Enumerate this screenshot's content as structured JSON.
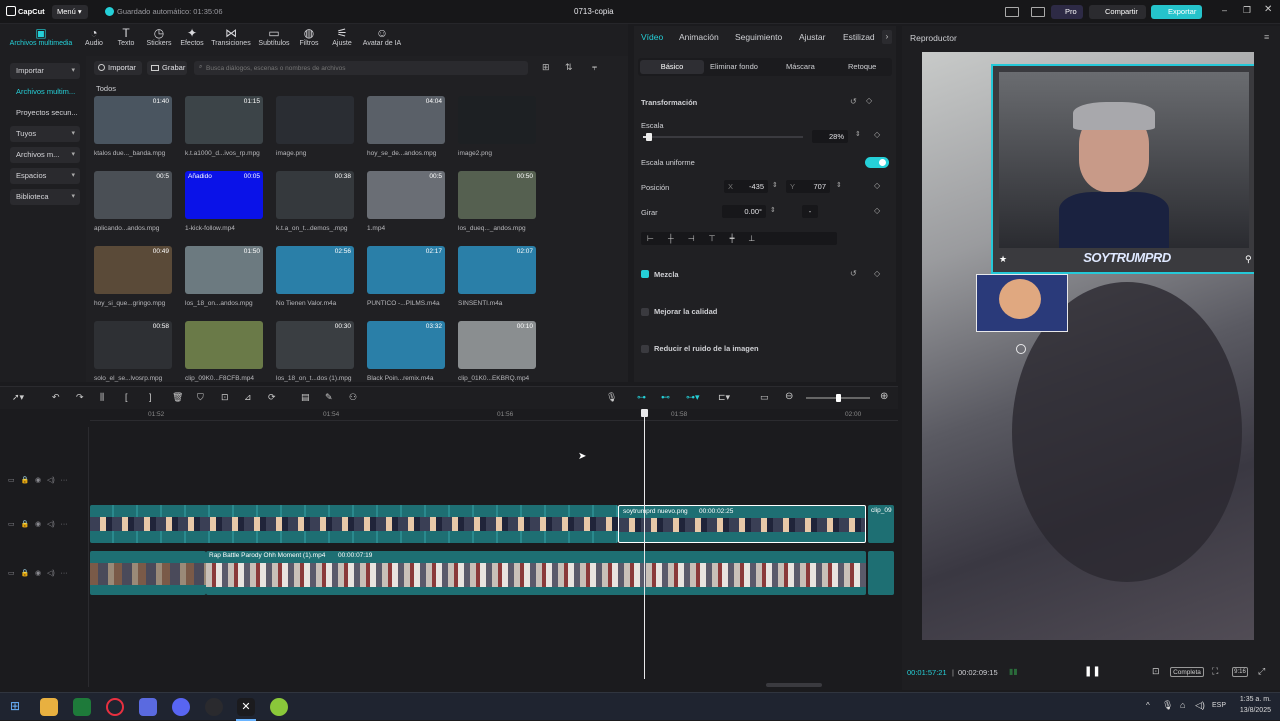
{
  "titlebar": {
    "app": "CapCut",
    "menu": "Menú",
    "autosave": "Guardado automático: 01:35:06",
    "project": "0713-copia",
    "pro": "Pro",
    "share": "Compartir",
    "export": "Exportar"
  },
  "media_tabs": [
    {
      "label": "Archivos multimedia",
      "icon": "media-icon"
    },
    {
      "label": "Audio",
      "icon": "audio-icon"
    },
    {
      "label": "Texto",
      "icon": "text-icon"
    },
    {
      "label": "Stickers",
      "icon": "sticker-icon"
    },
    {
      "label": "Efectos",
      "icon": "effects-icon"
    },
    {
      "label": "Transiciones",
      "icon": "transitions-icon"
    },
    {
      "label": "Subtítulos",
      "icon": "subtitles-icon"
    },
    {
      "label": "Filtros",
      "icon": "filters-icon"
    },
    {
      "label": "Ajuste",
      "icon": "adjust-icon"
    },
    {
      "label": "Avatar de IA",
      "icon": "avatar-icon"
    }
  ],
  "sidebar": [
    "Importar",
    "Archivos multim...",
    "Proyectos secun...",
    "Tuyos",
    "Archivos m...",
    "Espacios",
    "Biblioteca"
  ],
  "media": {
    "import": "Importar",
    "record": "Grabar",
    "search_placeholder": "Busca diálogos, escenas o nombres de archivos",
    "section": "Todos"
  },
  "media_items": [
    {
      "name": "ktalos due..._banda.mpg",
      "dur": "01:40",
      "color": "#4a5560"
    },
    {
      "name": "k.t.a1000_d...ivos_rp.mpg",
      "dur": "01:15",
      "color": "#3c4448"
    },
    {
      "name": "image.png",
      "dur": "",
      "color": "#2a2d33"
    },
    {
      "name": "hoy_se_de...andos.mpg",
      "dur": "04:04",
      "color": "#5a6068"
    },
    {
      "name": "image2.png",
      "dur": "",
      "color": "#1d2023"
    },
    {
      "name": "aplicando...andos.mpg",
      "dur": "00:5",
      "color": "#4a4f55"
    },
    {
      "name": "1-kick-follow.mp4",
      "dur": "00:05",
      "color": "#0a12e8",
      "badge": "Añadido"
    },
    {
      "name": "k.t.a_on_t...demos_.mpg",
      "dur": "00:38",
      "color": "#35393d"
    },
    {
      "name": "1.mp4",
      "dur": "00:5",
      "color": "#6a6e75"
    },
    {
      "name": "los_dueq..._andos.mpg",
      "dur": "00:50",
      "color": "#556050"
    },
    {
      "name": "hoy_si_que...gringo.mpg",
      "dur": "00:49",
      "color": "#5a4a38"
    },
    {
      "name": "los_18_on...andos.mpg",
      "dur": "01:50",
      "color": "#6c7a80"
    },
    {
      "name": "No Tienen Valor.m4a",
      "dur": "02:56",
      "color": "#2a7fa8"
    },
    {
      "name": "PUNTICO -...PILMS.m4a",
      "dur": "02:17",
      "color": "#2a7fa8"
    },
    {
      "name": "SINSENTI.m4a",
      "dur": "02:07",
      "color": "#2a7fa8"
    },
    {
      "name": "solo_el_se...lvosrp.mpg",
      "dur": "00:58",
      "color": "#2e3034"
    },
    {
      "name": "clip_09K0...F8CFB.mp4",
      "dur": "",
      "color": "#6a7a48"
    },
    {
      "name": "los_18_on_t...dos (1).mpg",
      "dur": "00:30",
      "color": "#3a3e42"
    },
    {
      "name": "Black Poin...remix.m4a",
      "dur": "03:32",
      "color": "#2a7fa8"
    },
    {
      "name": "clip_01K0...EKBRQ.mp4",
      "dur": "00:10",
      "color": "#8a8e90"
    }
  ],
  "props": {
    "tabs": [
      "Vídeo",
      "Animación",
      "Seguimiento",
      "Ajustar",
      "Estilizad"
    ],
    "subtabs": [
      "Básico",
      "Eliminar fondo",
      "Máscara",
      "Retoque"
    ],
    "transform": "Transformación",
    "scale_label": "Escala",
    "scale_value": "28%",
    "scale_fraction": 0.28,
    "uniform": "Escala uniforme",
    "position": "Posición",
    "x_label": "X",
    "x_value": "-435",
    "y_label": "Y",
    "y_value": "707",
    "rotate": "Girar",
    "rotate_value": "0.00°",
    "flip": "-",
    "blend": "Mezcla",
    "enhance": "Mejorar la calidad",
    "denoise": "Reducir el ruido de la imagen"
  },
  "player": {
    "title": "Reproductor",
    "current": "00:01:57:21",
    "total": "00:02:09:15",
    "ratio": "Completa",
    "aspect": "9:16",
    "overlay_text": "SOYTRUMPRD"
  },
  "timeline": {
    "ruler": [
      "01:52",
      "01:54",
      "01:56",
      "01:58",
      "02:00"
    ],
    "clip_label": "soytrumprd nuevo.png",
    "clip_time": "00:00:02:25",
    "audio_label": "Rap Battle Parody Ohh Moment (1).mp4",
    "audio_time": "00:00:07:19",
    "clip_end": "clip_09"
  },
  "taskbar": {
    "lang": "ESP",
    "time": "1:35 a. m.",
    "date": "13/8/2025"
  },
  "colors": {
    "accent": "#25d0d8",
    "track": "#1e6f73"
  }
}
